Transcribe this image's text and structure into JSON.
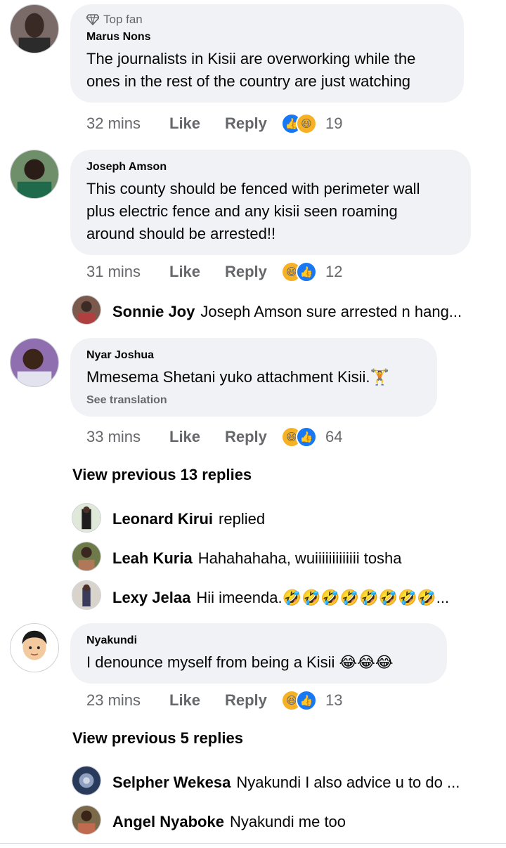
{
  "comments": [
    {
      "badge": "Top fan",
      "author": "Marus Nons",
      "lines": [
        "The journalists in Kisii are overworking while the",
        "ones in the rest of the country are just watching"
      ],
      "time": "32 mins",
      "like": "Like",
      "reply": "Reply",
      "count": "19"
    },
    {
      "author": "Joseph Amson",
      "lines": [
        "This county should be fenced with perimeter wall",
        "plus electric fence and any kisii seen roaming",
        "around should be arrested!!"
      ],
      "time": "31 mins",
      "like": "Like",
      "reply": "Reply",
      "count": "12"
    },
    {
      "author": "Nyar Joshua",
      "lines": [
        "Mmesema Shetani yuko attachment Kisii.🏋"
      ],
      "see_translation": "See translation",
      "time": "33 mins",
      "like": "Like",
      "reply": "Reply",
      "count": "64"
    },
    {
      "author": "Nyakundi",
      "lines": [
        "I denounce myself from being a Kisii 😂😂😂"
      ],
      "time": "23 mins",
      "like": "Like",
      "reply": "Reply",
      "count": "13"
    }
  ],
  "replies": [
    {
      "name": "Sonnie Joy",
      "text": "Joseph Amson sure arrested n hang..."
    },
    {
      "name": "Leonard Kirui",
      "text": "replied"
    },
    {
      "name": "Leah Kuria",
      "text": "Hahahahaha, wuiiiiiiiiiiiii tosha"
    },
    {
      "name": "Lexy Jelaa",
      "text": "Hii imeenda.🤣🤣🤣🤣🤣🤣🤣🤣..."
    },
    {
      "name": "Selpher Wekesa",
      "text": "Nyakundi I also advice u to do ..."
    },
    {
      "name": "Angel Nyaboke",
      "text": "Nyakundi me too"
    }
  ],
  "view_previous_1": "View previous 13 replies",
  "view_previous_2": "View previous 5 replies",
  "colors": {
    "like_blue": "#1877f2",
    "haha_yellow": "#f7b125",
    "bubble": "#f0f2f5",
    "meta_gray": "#65676b"
  },
  "icons": {
    "badge": "diamond-icon",
    "like_reaction": "thumbs-up-icon",
    "haha_reaction": "laughing-face-icon"
  }
}
